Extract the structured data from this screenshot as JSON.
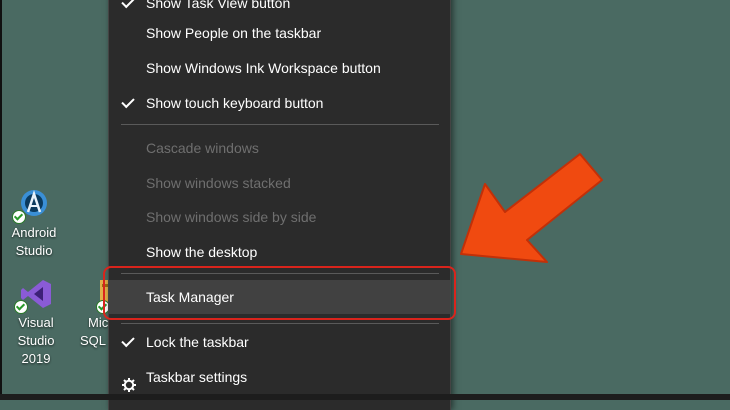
{
  "menu": {
    "items": [
      {
        "label": "Show Task View button",
        "checked": true,
        "disabled": false
      },
      {
        "label": "Show People on the taskbar",
        "checked": false,
        "disabled": false
      },
      {
        "label": "Show Windows Ink Workspace button",
        "checked": false,
        "disabled": false
      },
      {
        "label": "Show touch keyboard button",
        "checked": true,
        "disabled": false
      },
      {
        "label": "Cascade windows",
        "checked": false,
        "disabled": true
      },
      {
        "label": "Show windows stacked",
        "checked": false,
        "disabled": true
      },
      {
        "label": "Show windows side by side",
        "checked": false,
        "disabled": true
      },
      {
        "label": "Show the desktop",
        "checked": false,
        "disabled": false
      },
      {
        "label": "Task Manager",
        "checked": false,
        "disabled": false,
        "highlighted": true
      },
      {
        "label": "Lock the taskbar",
        "checked": true,
        "disabled": false
      },
      {
        "label": "Taskbar settings",
        "checked": false,
        "disabled": false,
        "icon": "gear-icon"
      }
    ]
  },
  "desktop": {
    "icons": [
      {
        "label_line1": "Android",
        "label_line2": "Studio",
        "icon": "android-studio-icon"
      },
      {
        "label_line1": "Visual Studio",
        "label_line2": "2019",
        "icon": "visual-studio-icon"
      },
      {
        "label_line1": "Mic",
        "label_line2": "SQL S",
        "icon": "sql-server-icon"
      }
    ]
  },
  "colors": {
    "desktop_background": "#4a6a62",
    "menu_background": "#2b2b2b",
    "highlight": "#414141",
    "annotation_red": "#d9241c",
    "arrow_orange": "#f04a10"
  }
}
